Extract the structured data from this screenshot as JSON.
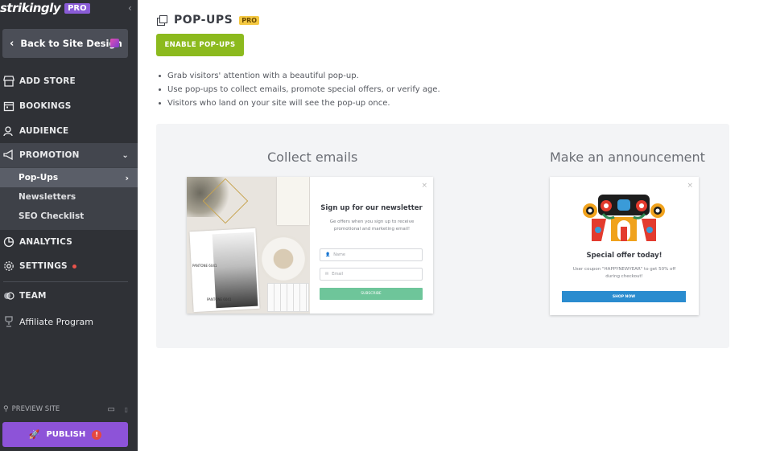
{
  "sidebar": {
    "brand": "strikingly",
    "brand_badge": "PRO",
    "back_label": "Back to Site Design",
    "nav": [
      {
        "label": "ADD STORE",
        "icon": "store-icon"
      },
      {
        "label": "BOOKINGS",
        "icon": "calendar-icon"
      },
      {
        "label": "AUDIENCE",
        "icon": "audience-icon"
      },
      {
        "label": "PROMOTION",
        "icon": "megaphone-icon"
      },
      {
        "label": "ANALYTICS",
        "icon": "chart-icon"
      },
      {
        "label": "SETTINGS",
        "icon": "gear-icon"
      },
      {
        "label": "TEAM",
        "icon": "team-icon"
      },
      {
        "label": "Affiliate Program",
        "icon": "trophy-icon"
      }
    ],
    "promotion_sub": [
      {
        "label": "Pop-Ups",
        "active": true
      },
      {
        "label": "Newsletters"
      },
      {
        "label": "SEO Checklist"
      }
    ],
    "preview_label": "PREVIEW SITE",
    "publish_label": "PUBLISH",
    "publish_alert": "!"
  },
  "main": {
    "title": "POP-UPS",
    "title_badge": "PRO",
    "enable_label": "ENABLE POP-UPS",
    "bullets": [
      "Grab visitors' attention with a beautiful pop-up.",
      "Use pop-ups to collect emails, promote special offers, or verify age.",
      "Visitors who land on your site will see the pop-up once."
    ],
    "examples": {
      "collect": {
        "title": "Collect emails",
        "popup_heading": "Sign up for our newsletter",
        "popup_sub": "Ge offers when you sign up to receive promotional and marketing email!",
        "name_placeholder": "Name",
        "email_placeholder": "Email",
        "button": "SUBSCRIBE",
        "pantone_1": "PANTONE 6041",
        "pantone_2": "PANTONE 6041"
      },
      "announce": {
        "title": "Make an announcement",
        "popup_heading": "Special offer today!",
        "popup_sub": "User coupon \"HAPPYNEWYEAR\" to get 50% off during checkout!",
        "button": "SHOP NOW"
      }
    }
  },
  "colors": {
    "sidebar_bg": "#2f3136",
    "accent_green": "#8cba1e",
    "publish_purple": "#8d53d8",
    "pro_yellow": "#f4c842",
    "shop_blue": "#2a8ccf"
  }
}
